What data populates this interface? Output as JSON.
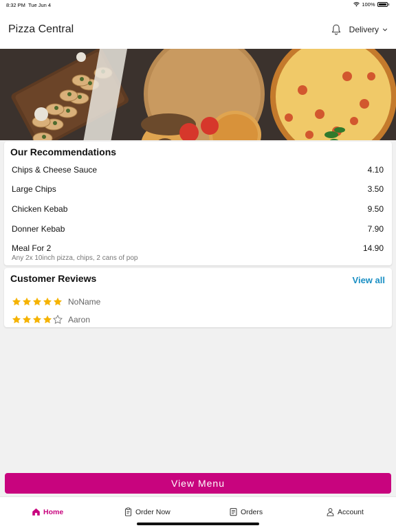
{
  "status_bar": {
    "time": "8:32 PM",
    "date": "Tue Jun 4",
    "battery": "100%"
  },
  "header": {
    "title": "Pizza Central",
    "delivery_label": "Delivery"
  },
  "recommendations": {
    "title": "Our Recommendations",
    "items": [
      {
        "name": "Chips & Cheese Sauce",
        "price": "4.10",
        "description": ""
      },
      {
        "name": "Large Chips",
        "price": "3.50",
        "description": ""
      },
      {
        "name": "Chicken Kebab",
        "price": "9.50",
        "description": ""
      },
      {
        "name": "Donner Kebab",
        "price": "7.90",
        "description": ""
      },
      {
        "name": "Meal For 2",
        "price": "14.90",
        "description": "Any 2x 10inch pizza, chips, 2 cans of pop"
      }
    ]
  },
  "reviews": {
    "title": "Customer Reviews",
    "view_all_label": "View all",
    "items": [
      {
        "name": "NoName",
        "rating": 5
      },
      {
        "name": "Aaron",
        "rating": 4
      }
    ]
  },
  "view_menu_label": "View Menu",
  "tabs": [
    {
      "label": "Home",
      "icon": "home-icon",
      "active": true
    },
    {
      "label": "Order Now",
      "icon": "clipboard-icon",
      "active": false
    },
    {
      "label": "Orders",
      "icon": "receipt-icon",
      "active": false
    },
    {
      "label": "Account",
      "icon": "person-icon",
      "active": false
    }
  ],
  "colors": {
    "accent": "#c8047e",
    "link": "#1a8fc4",
    "star": "#f5b301"
  }
}
